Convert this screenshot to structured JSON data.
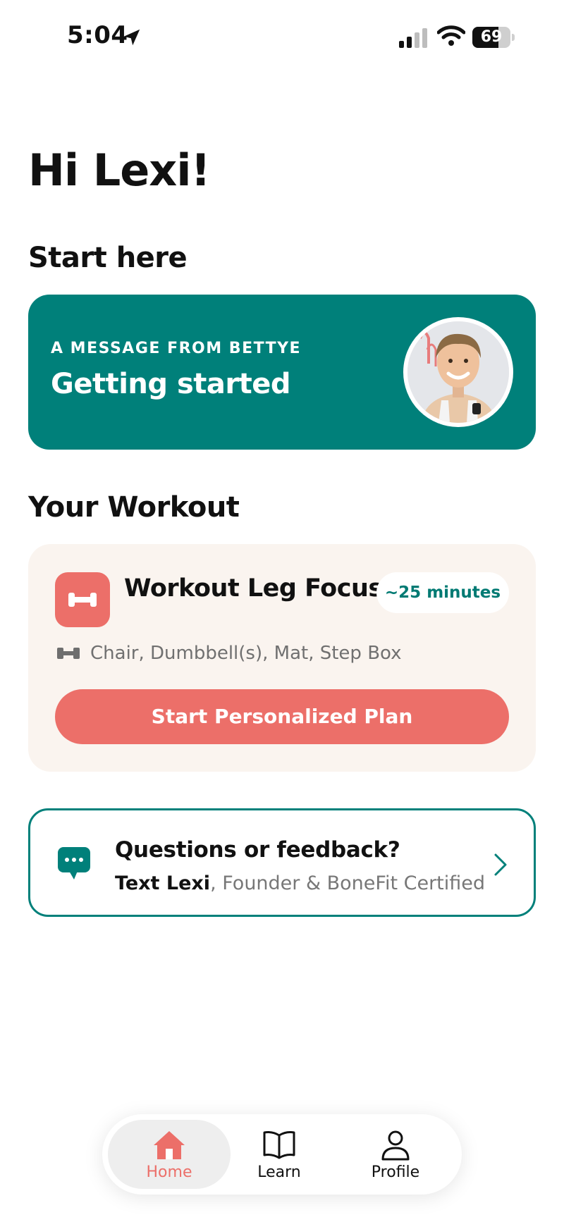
{
  "status_bar": {
    "time": "5:04",
    "battery": "69",
    "battery_level": 0.69
  },
  "greeting": "Hi Lexi!",
  "sections": {
    "start_here": "Start here",
    "your_workout": "Your Workout"
  },
  "message_card": {
    "eyebrow": "A MESSAGE FROM BETTYE",
    "title": "Getting started"
  },
  "workout": {
    "title": "Workout Leg Focus",
    "duration": "~25 minutes",
    "equipment": "Chair, Dumbbell(s), Mat, Step Box",
    "start_label": "Start Personalized Plan"
  },
  "feedback": {
    "title": "Questions or feedback?",
    "sub_strong": "Text Lexi",
    "sub_rest": ", Founder & BoneFit Certified"
  },
  "tabs": [
    {
      "label": "Home",
      "icon": "home-icon",
      "active": true
    },
    {
      "label": "Learn",
      "icon": "book-icon",
      "active": false
    },
    {
      "label": "Profile",
      "icon": "person-icon",
      "active": false
    }
  ],
  "colors": {
    "teal": "#00807a",
    "coral": "#ec6f69",
    "cream": "#faf4ef"
  }
}
